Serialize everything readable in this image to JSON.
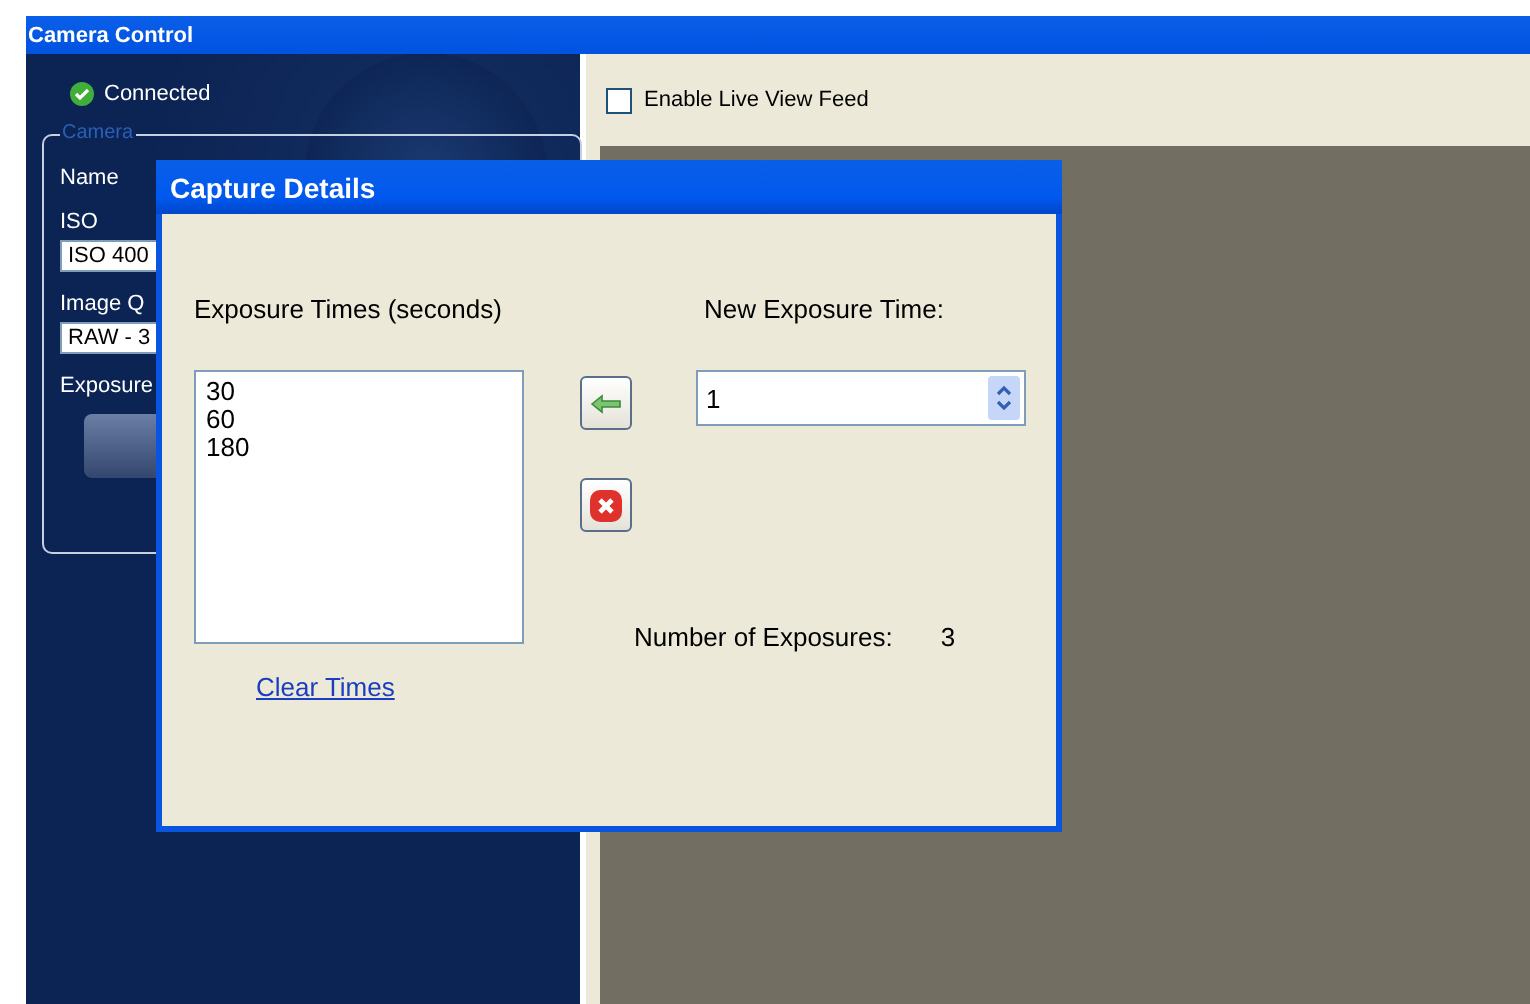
{
  "window": {
    "title": "Camera Control"
  },
  "sidebar": {
    "status": "Connected",
    "group_title": "Camera",
    "fields": [
      {
        "label": "Name"
      },
      {
        "label": "ISO",
        "value": "ISO 400"
      },
      {
        "label": "Image Q",
        "value": "RAW - 3"
      },
      {
        "label": "Exposure",
        "kind": "button"
      }
    ]
  },
  "live_view": {
    "label": "Enable Live View Feed",
    "checked": false
  },
  "dialog": {
    "title": "Capture Details",
    "list_label": "Exposure Times (seconds)",
    "times": [
      "30",
      "60",
      "180"
    ],
    "clear_link": "Clear Times",
    "new_time_label": "New Exposure Time:",
    "new_time_value": "1",
    "count_label": "Number of Exposures:",
    "count": "3"
  }
}
